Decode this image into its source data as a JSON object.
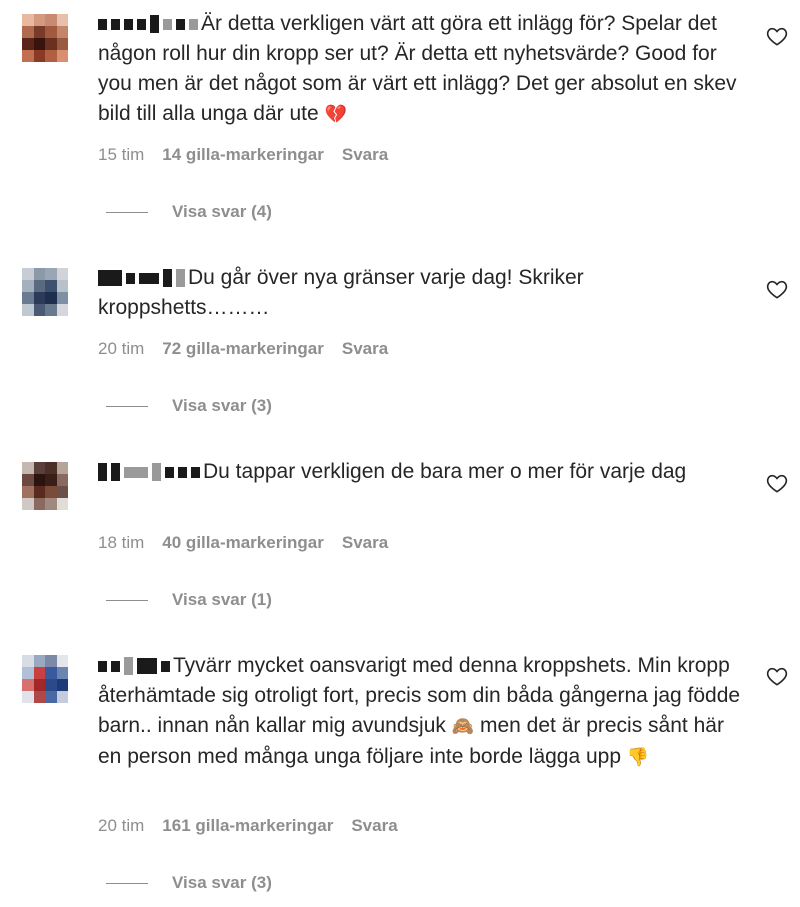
{
  "comments": [
    {
      "text": "Är detta verkligen värt att göra ett inlägg för? Spelar det någon roll hur din kropp ser ut? Är detta ett nyhetsvärde? Good for you men är det något som är värt ett inlägg? Det ger absolut en skev bild till alla unga där ute",
      "emoji": "💔",
      "time": "15 tim",
      "likes": "14 gilla-markeringar",
      "reply": "Svara",
      "view_replies": "Visa svar (4)"
    },
    {
      "text": "Du går över nya gränser varje dag! Skriker kroppshetts………",
      "emoji": "",
      "time": "20 tim",
      "likes": "72 gilla-markeringar",
      "reply": "Svara",
      "view_replies": "Visa svar (3)"
    },
    {
      "text": "Du tappar verkligen de bara mer o mer för varje dag",
      "emoji": "",
      "time": "18 tim",
      "likes": "40 gilla-markeringar",
      "reply": "Svara",
      "view_replies": "Visa svar (1)"
    },
    {
      "text": "Tyvärr mycket oansvarigt med denna kroppshets. Min kropp återhämtade sig otroligt fort, precis som din båda gångerna jag födde barn.. innan nån kallar mig avundsjuk",
      "emoji_mid": "🙈",
      "text_after": "men det är precis sånt här en person med många unga följare inte borde lägga upp",
      "emoji": "👎",
      "time": "20 tim",
      "likes": "161 gilla-markeringar",
      "reply": "Svara",
      "view_replies": "Visa svar (3)"
    }
  ],
  "icons": {
    "like": "heart-outline-icon",
    "avatar": "pixelated-avatar-icon"
  },
  "colors": {
    "text": "#262626",
    "muted": "#8e8e8e",
    "heart_broken": "#e0245e"
  }
}
